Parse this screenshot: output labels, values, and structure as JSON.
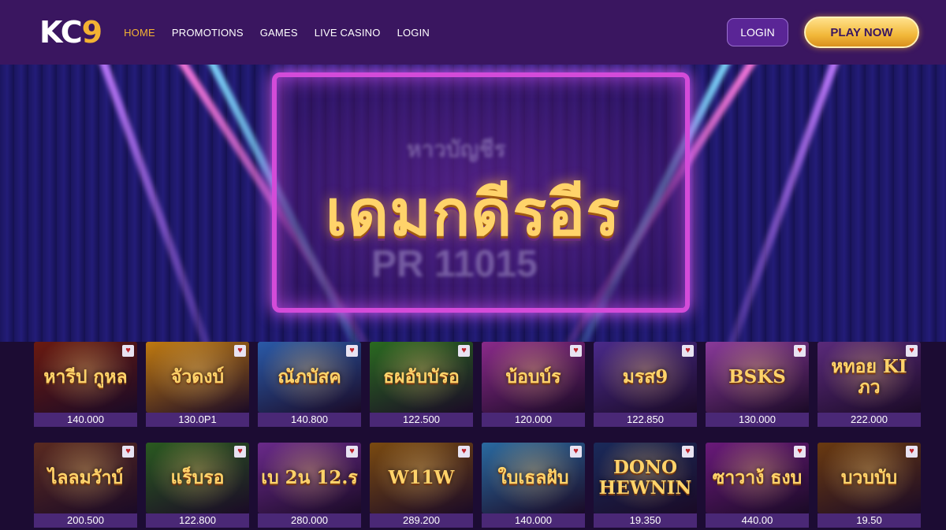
{
  "header": {
    "logo_text": "KC",
    "logo_accent": "9",
    "nav": [
      {
        "label": "HOME",
        "active": true
      },
      {
        "label": "PROMOTIONS",
        "active": false
      },
      {
        "label": "GAMES",
        "active": false
      },
      {
        "label": "LIVE CASINO",
        "active": false
      },
      {
        "label": "LOGIN",
        "active": false
      }
    ],
    "login_button": "LOGIN",
    "play_button": "PLAY NOW"
  },
  "hero": {
    "title": "เดมกดีรอีร",
    "faded_top": "หาวบัญชีร",
    "faded_bottom": "PR 11015"
  },
  "favorite_icon": "favorite-icon",
  "games": [
    {
      "title": "หารีป กูหล",
      "amount": "140.000",
      "color": "#6a1a10"
    },
    {
      "title": "จัวดงบ์",
      "amount": "130.0P1",
      "color": "#c07a10"
    },
    {
      "title": "ณัภบัสค",
      "amount": "140.800",
      "color": "#2a5aa8"
    },
    {
      "title": "ธผอับบัรอ",
      "amount": "122.500",
      "color": "#2a6a20"
    },
    {
      "title": "บ้อบบ์ร",
      "amount": "120.000",
      "color": "#8a2a8a"
    },
    {
      "title": "มรส9",
      "amount": "122.850",
      "color": "#4a2a8a"
    },
    {
      "title": "BSKS",
      "amount": "130.000",
      "color": "#8a3a9a"
    },
    {
      "title": "หทอย KI ภว",
      "amount": "222.000",
      "color": "#5a2a7a"
    },
    {
      "title": "ไลลมวัาบ์",
      "amount": "200.500",
      "color": "#5a2a20"
    },
    {
      "title": "แร็บรอ",
      "amount": "122.800",
      "color": "#2a5a20"
    },
    {
      "title": "เบ 2น 12.ร",
      "amount": "280.000",
      "color": "#6a2a8a"
    },
    {
      "title": "W11W",
      "amount": "289.200",
      "color": "#7a4a10"
    },
    {
      "title": "ใบเธลฝับ",
      "amount": "140.000",
      "color": "#2a6aa0"
    },
    {
      "title": "DONO HEWNIN",
      "amount": "19.350",
      "color": "#1a2a5a"
    },
    {
      "title": "ซาวาง้ ธงบ",
      "amount": "440.00",
      "color": "#6a1a7a"
    },
    {
      "title": "บวบบับ",
      "amount": "19.50",
      "color": "#6a3a10"
    }
  ]
}
